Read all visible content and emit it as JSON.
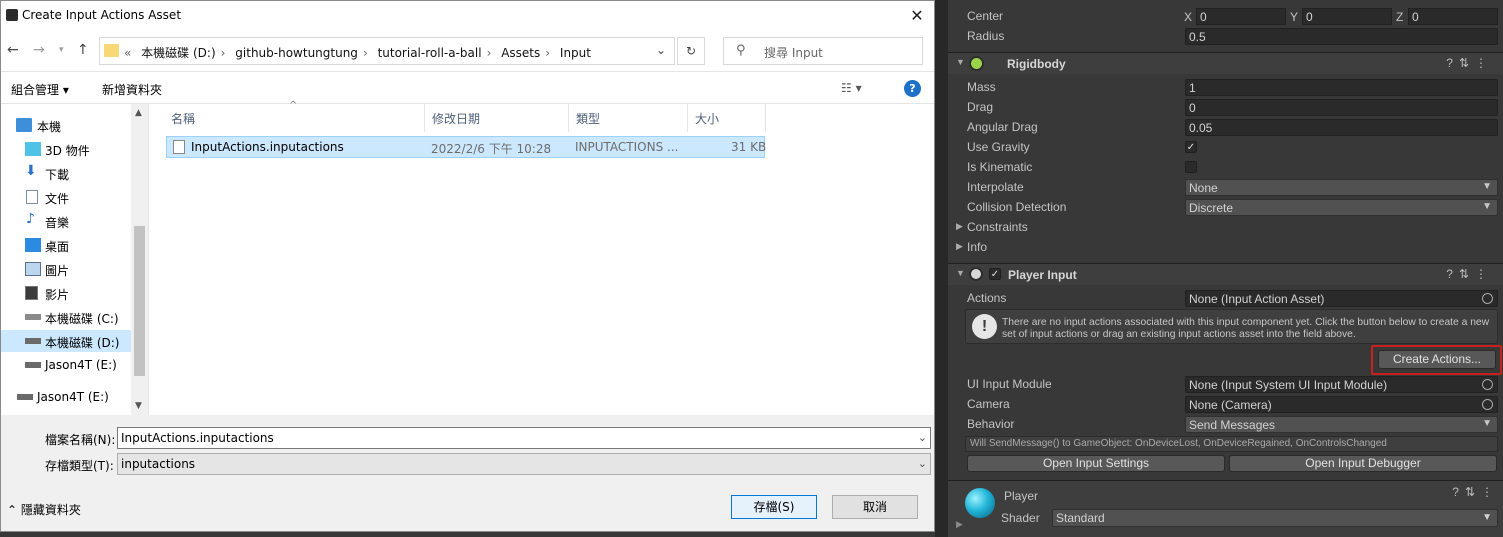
{
  "dialog": {
    "title": "Create Input Actions Asset",
    "breadcrumbs": [
      "本機磁碟 (D:)",
      "github-howtungtung",
      "tutorial-roll-a-ball",
      "Assets",
      "Input"
    ],
    "breadcrumb_prefix": "«",
    "search_placeholder": "搜尋 Input",
    "organize_label": "組合管理 ▾",
    "new_folder_label": "新增資料夾",
    "columns": [
      "名稱",
      "修改日期",
      "類型",
      "大小"
    ],
    "file": {
      "name": "InputActions.inputactions",
      "modified": "2022/2/6 下午 10:28",
      "type": "INPUTACTIONS ...",
      "size": "31 KB"
    },
    "sidebar": [
      {
        "label": "本機",
        "icon": "computer-icon"
      },
      {
        "label": "3D 物件",
        "icon": "cube-icon"
      },
      {
        "label": "下載",
        "icon": "download-icon"
      },
      {
        "label": "文件",
        "icon": "document-icon"
      },
      {
        "label": "音樂",
        "icon": "music-icon"
      },
      {
        "label": "桌面",
        "icon": "desktop-icon"
      },
      {
        "label": "圖片",
        "icon": "picture-icon"
      },
      {
        "label": "影片",
        "icon": "video-icon"
      },
      {
        "label": "本機磁碟 (C:)",
        "icon": "drive-icon"
      },
      {
        "label": "本機磁碟 (D:)",
        "icon": "drive-icon"
      },
      {
        "label": "Jason4T (E:)",
        "icon": "drive-icon"
      },
      {
        "label": "Jason4T (E:)",
        "icon": "drive-icon"
      }
    ],
    "filename_label": "檔案名稱(N):",
    "filename_value": "InputActions.inputactions",
    "filetype_label": "存檔類型(T):",
    "filetype_value": "inputactions",
    "hide_folders": "隱藏資料夾",
    "save_button": "存檔(S)",
    "cancel_button": "取消"
  },
  "inspector": {
    "collider": {
      "center_label": "Center",
      "center": {
        "x": "0",
        "y": "0",
        "z": "0"
      },
      "radius_label": "Radius",
      "radius": "0.5"
    },
    "rigidbody": {
      "title": "Rigidbody",
      "mass_label": "Mass",
      "mass": "1",
      "drag_label": "Drag",
      "drag": "0",
      "angular_drag_label": "Angular Drag",
      "angular_drag": "0.05",
      "use_gravity_label": "Use Gravity",
      "is_kinematic_label": "Is Kinematic",
      "interpolate_label": "Interpolate",
      "interpolate": "None",
      "collision_label": "Collision Detection",
      "collision": "Discrete",
      "constraints_label": "Constraints",
      "info_label": "Info"
    },
    "player_input": {
      "title": "Player Input",
      "actions_label": "Actions",
      "actions": "None (Input Action Asset)",
      "help_message": "There are no input actions associated with this input component yet. Click the button below to create a new set of input actions or drag an existing input actions asset into the field above.",
      "create_actions": "Create Actions...",
      "ui_module_label": "UI Input Module",
      "ui_module": "None (Input System UI Input Module)",
      "camera_label": "Camera",
      "camera": "None (Camera)",
      "behavior_label": "Behavior",
      "behavior": "Send Messages",
      "behavior_info": "Will SendMessage() to GameObject: OnDeviceLost, OnDeviceRegained, OnControlsChanged",
      "open_settings": "Open Input Settings",
      "open_debugger": "Open Input Debugger"
    },
    "material": {
      "name": "Player",
      "shader_label": "Shader",
      "shader": "Standard"
    }
  },
  "colors": {
    "highlight": "#c81f1f",
    "selection": "#cce8ff",
    "unity_bg": "#383838"
  }
}
